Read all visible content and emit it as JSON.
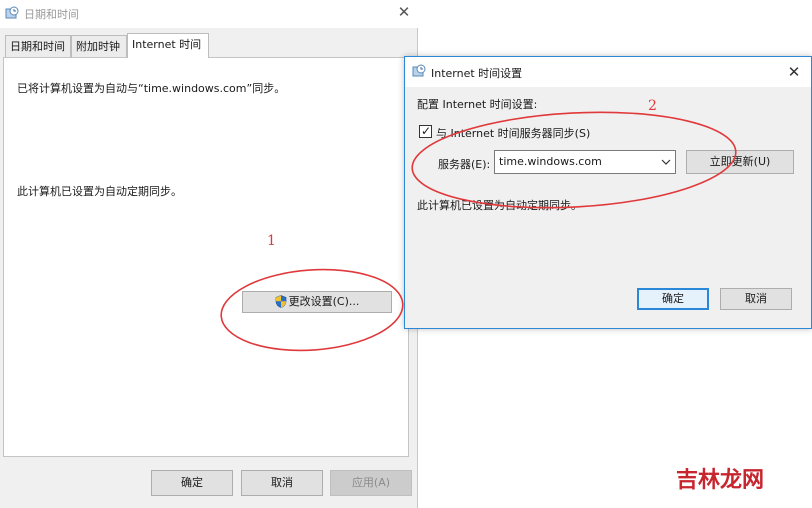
{
  "outer_window": {
    "title": "日期和时间",
    "tabs": [
      {
        "label": "日期和时间",
        "active": false
      },
      {
        "label": "附加时钟",
        "active": false
      },
      {
        "label": "Internet 时间",
        "active": true
      }
    ],
    "panel_text_sync": "已将计算机设置为自动与“time.windows.com”同步。",
    "panel_text_schedule": "此计算机已设置为自动定期同步。",
    "change_settings_label": "更改设置(C)...",
    "ok_label": "确定",
    "cancel_label": "取消",
    "apply_label": "应用(A)"
  },
  "dialog": {
    "title": "Internet 时间设置",
    "heading": "配置 Internet 时间设置:",
    "sync_checkbox_label": "与 Internet 时间服务器同步(S)",
    "sync_checked": true,
    "server_label": "服务器(E):",
    "server_value": "time.windows.com",
    "update_now_label": "立即更新(U)",
    "status_text": "此计算机已设置为自动定期同步。",
    "ok_label": "确定",
    "cancel_label": "取消"
  },
  "annotations": {
    "marker_1": "1",
    "marker_2": "2",
    "color": "#e0393b"
  },
  "watermark": {
    "text": "吉林龙网",
    "color": "#c8262f"
  },
  "icons": {
    "window_icon": "clock-globe-icon",
    "shield": "uac-shield-icon",
    "close": "close-icon",
    "dropdown": "chevron-down-icon",
    "checkbox": "checkmark-icon"
  },
  "colors": {
    "accent": "#2b88d8",
    "window_bg": "#f0f0f0",
    "button_bg": "#e1e1e1"
  }
}
